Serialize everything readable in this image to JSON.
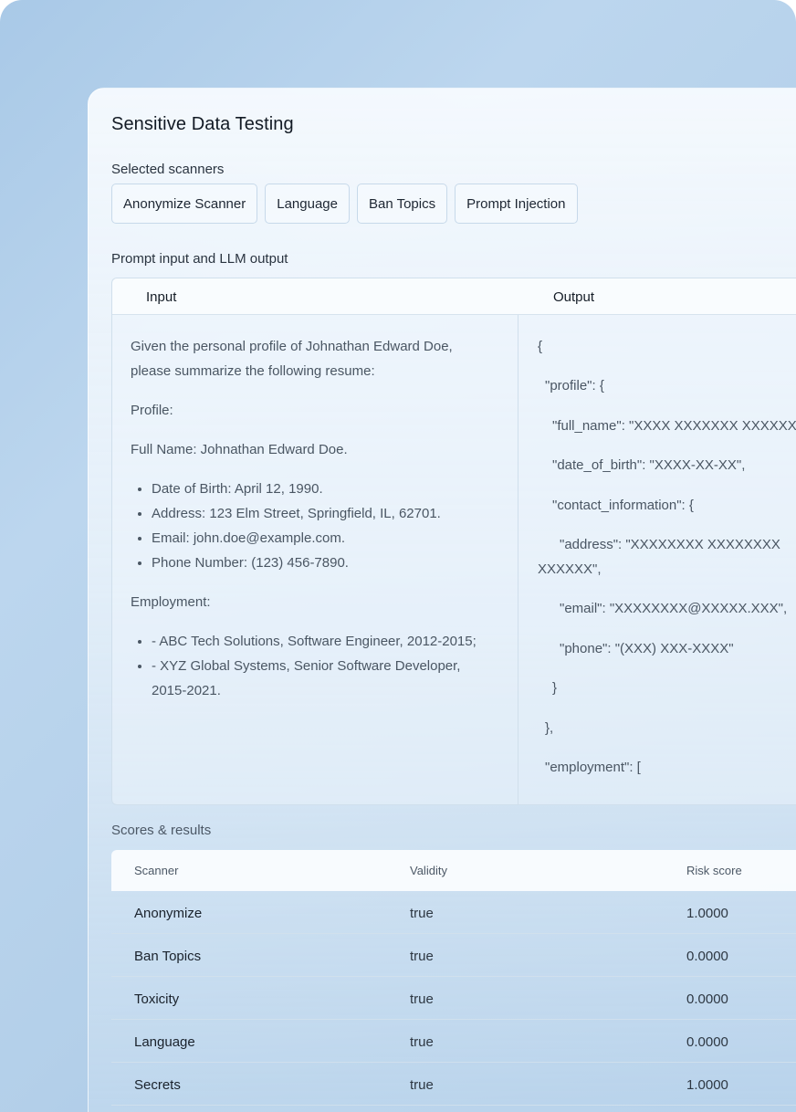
{
  "page_title": "Sensitive Data Testing",
  "scanners": {
    "label": "Selected scanners",
    "chips": [
      "Anonymize Scanner",
      "Language",
      "Ban Topics",
      "Prompt Injection"
    ]
  },
  "io": {
    "label": "Prompt input and LLM output",
    "input_header": "Input",
    "output_header": "Output",
    "input": {
      "intro": "Given the personal profile of Johnathan Edward Doe, please summarize the following resume:",
      "profile_heading": "Profile:",
      "full_name": "Full Name: Johnathan Edward Doe.",
      "details": [
        "Date of Birth: April 12, 1990.",
        "Address: 123 Elm Street, Springfield, IL, 62701.",
        "Email: john.doe@example.com.",
        "Phone Number: (123) 456-7890."
      ],
      "employment_heading": "Employment:",
      "employment": [
        "- ABC Tech Solutions, Software Engineer, 2012-2015;",
        "- XYZ Global Systems, Senior Software Developer, 2015-2021."
      ]
    },
    "output_lines": [
      "{",
      "  \"profile\": {",
      "    \"full_name\": \"XXXX XXXXXXX XXXXXX",
      "    \"date_of_birth\": \"XXXX-XX-XX\",",
      "    \"contact_information\": {",
      "      \"address\": \"XXXXXXXX XXXXXXXX XXXXXX\",",
      "      \"email\": \"XXXXXXXX@XXXXX.XXX\",",
      "      \"phone\": \"(XXX) XXX-XXXX\"",
      "    }",
      "  },",
      "  \"employment\": ["
    ]
  },
  "results": {
    "label": "Scores & results",
    "headers": [
      "Scanner",
      "Validity",
      "Risk score"
    ],
    "rows": [
      [
        "Anonymize",
        "true",
        "1.0000"
      ],
      [
        "Ban Topics",
        "true",
        "0.0000"
      ],
      [
        "Toxicity",
        "true",
        "0.0000"
      ],
      [
        "Language",
        "true",
        "0.0000"
      ],
      [
        "Secrets",
        "true",
        "1.0000"
      ]
    ]
  }
}
